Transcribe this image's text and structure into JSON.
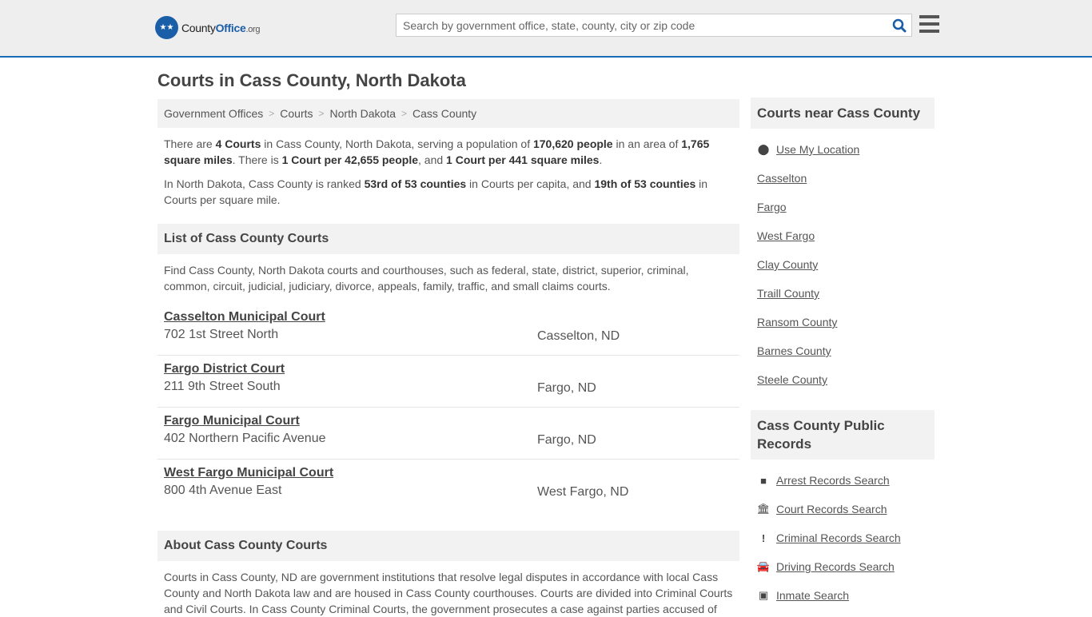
{
  "header": {
    "logo": {
      "part1": "County",
      "part2": "Office",
      "part3": ".org"
    },
    "search_placeholder": "Search by government office, state, county, city or zip code"
  },
  "page_title": "Courts in Cass County, North Dakota",
  "breadcrumb": [
    "Government Offices",
    "Courts",
    "North Dakota",
    "Cass County"
  ],
  "intro": {
    "p1": [
      {
        "t": "There are "
      },
      {
        "b": "4 Courts"
      },
      {
        "t": " in Cass County, North Dakota, serving a population of "
      },
      {
        "b": "170,620 people"
      },
      {
        "t": " in an area of "
      },
      {
        "b": "1,765 square miles"
      },
      {
        "t": ". There is "
      },
      {
        "b": "1 Court per 42,655 people"
      },
      {
        "t": ", and "
      },
      {
        "b": "1 Court per 441 square miles"
      },
      {
        "t": "."
      }
    ],
    "p2": [
      {
        "t": "In North Dakota, Cass County is ranked "
      },
      {
        "b": "53rd of 53 counties"
      },
      {
        "t": " in Courts per capita, and "
      },
      {
        "b": "19th of 53 counties"
      },
      {
        "t": " in Courts per square mile."
      }
    ]
  },
  "list_section": {
    "title": "List of Cass County Courts",
    "desc": "Find Cass County, North Dakota courts and courthouses, such as federal, state, district, superior, criminal, common, circuit, judicial, judiciary, divorce, appeals, family, traffic, and small claims courts."
  },
  "courts": [
    {
      "name": "Casselton Municipal Court",
      "address": "702 1st Street North",
      "city": "Casselton, ND"
    },
    {
      "name": "Fargo District Court",
      "address": "211 9th Street South",
      "city": "Fargo, ND"
    },
    {
      "name": "Fargo Municipal Court",
      "address": "402 Northern Pacific Avenue",
      "city": "Fargo, ND"
    },
    {
      "name": "West Fargo Municipal Court",
      "address": "800 4th Avenue East",
      "city": "West Fargo, ND"
    }
  ],
  "about": {
    "title": "About Cass County Courts",
    "text": "Courts in Cass County, ND are government institutions that resolve legal disputes in accordance with local Cass County and North Dakota law and are housed in Cass County courthouses. Courts are divided into Criminal Courts and Civil Courts. In Cass County Criminal Courts, the government prosecutes a case against parties accused of"
  },
  "sidebar": {
    "nearby_title": "Courts near Cass County",
    "use_location": "Use My Location",
    "nearby": [
      "Casselton",
      "Fargo",
      "West Fargo",
      "Clay County",
      "Traill County",
      "Ransom County",
      "Barnes County",
      "Steele County"
    ],
    "records_title": "Cass County Public Records",
    "records": [
      {
        "label": "Arrest Records Search",
        "icon": "■"
      },
      {
        "label": "Court Records Search",
        "icon": "🏛"
      },
      {
        "label": "Criminal Records Search",
        "icon": "!"
      },
      {
        "label": "Driving Records Search",
        "icon": "🚘"
      },
      {
        "label": "Inmate Search",
        "icon": "▣"
      }
    ]
  }
}
